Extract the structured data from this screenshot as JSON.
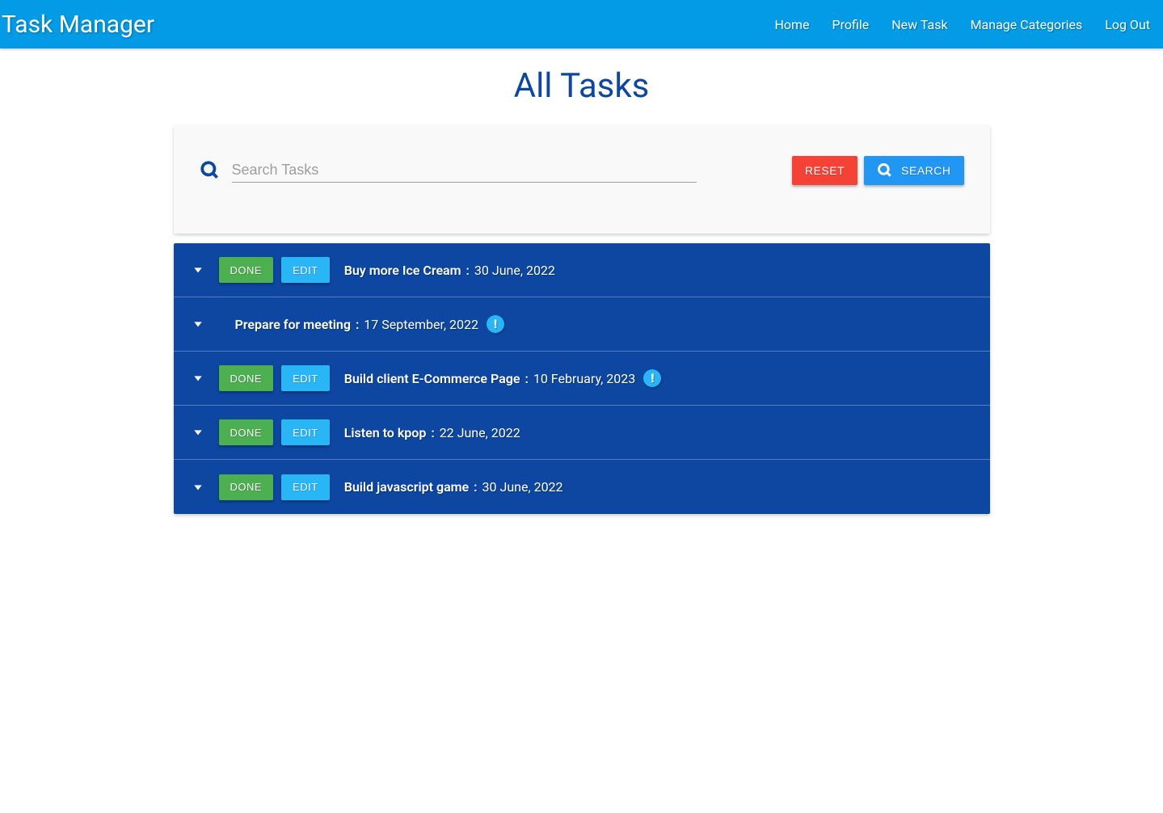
{
  "header": {
    "brand": "Task Manager",
    "nav": {
      "home": "Home",
      "profile": "Profile",
      "newTask": "New Task",
      "manageCategories": "Manage Categories",
      "logOut": "Log Out"
    }
  },
  "page": {
    "title": "All Tasks"
  },
  "search": {
    "placeholder": "Search Tasks",
    "value": "",
    "resetLabel": "RESET",
    "searchLabel": "SEARCH"
  },
  "buttons": {
    "done": "DONE",
    "edit": "EDIT"
  },
  "tasks": [
    {
      "title": "Buy more Ice Cream",
      "date": "30 June, 2022",
      "hasActions": true,
      "alert": false
    },
    {
      "title": "Prepare for meeting",
      "date": "17 September, 2022",
      "hasActions": false,
      "alert": true
    },
    {
      "title": "Build client E-Commerce Page",
      "date": "10 February, 2023",
      "hasActions": true,
      "alert": true
    },
    {
      "title": "Listen to kpop",
      "date": "22 June, 2022",
      "hasActions": true,
      "alert": false
    },
    {
      "title": "Build javascript game",
      "date": "30 June, 2022",
      "hasActions": true,
      "alert": false
    }
  ],
  "colors": {
    "navbar": "#039be5",
    "primaryDark": "#0d47a1",
    "reset": "#f44336",
    "search": "#2196f3",
    "done": "#4caf50",
    "edit": "#29b6f6"
  }
}
